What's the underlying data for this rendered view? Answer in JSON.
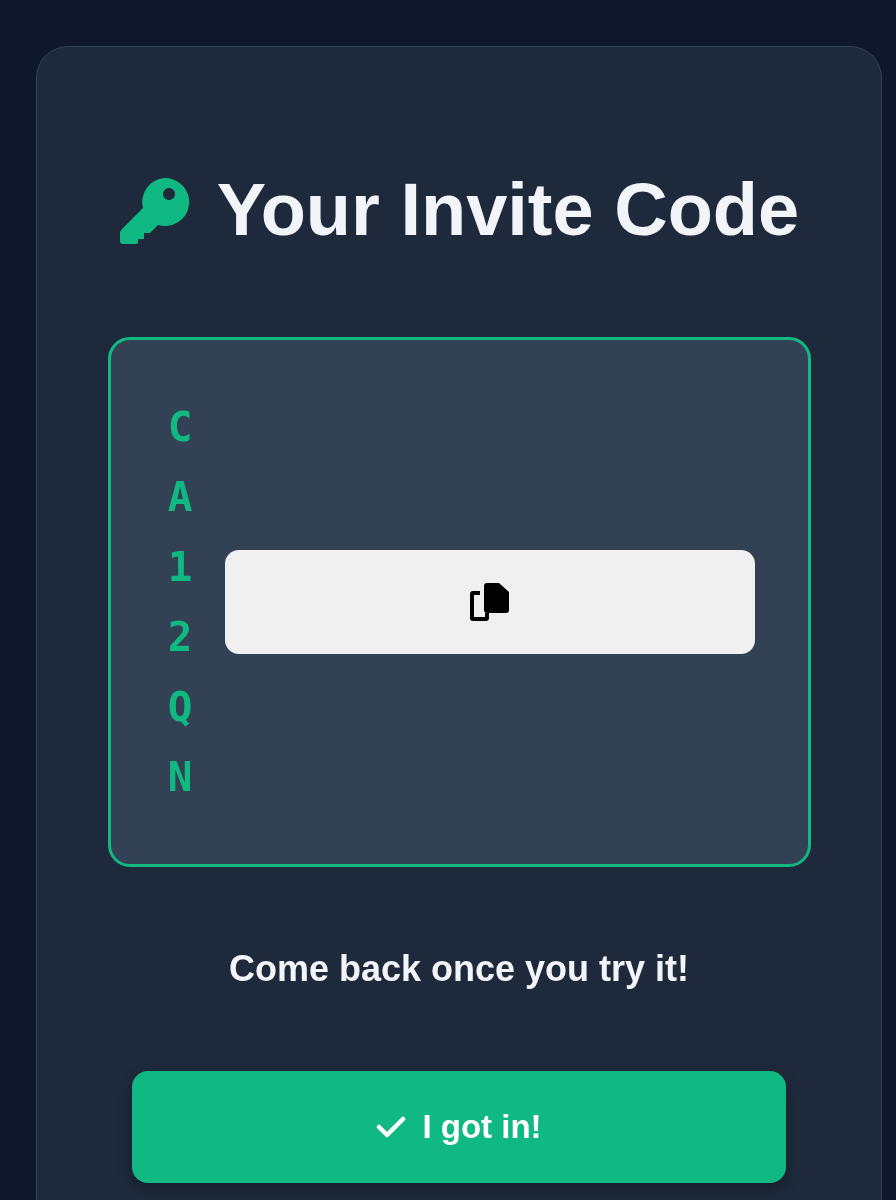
{
  "title": {
    "text": "Your Invite Code"
  },
  "invite_code": {
    "code": "CA12QN"
  },
  "message": "Come back once you try it!",
  "confirm_button": {
    "label": "I got in!"
  }
}
